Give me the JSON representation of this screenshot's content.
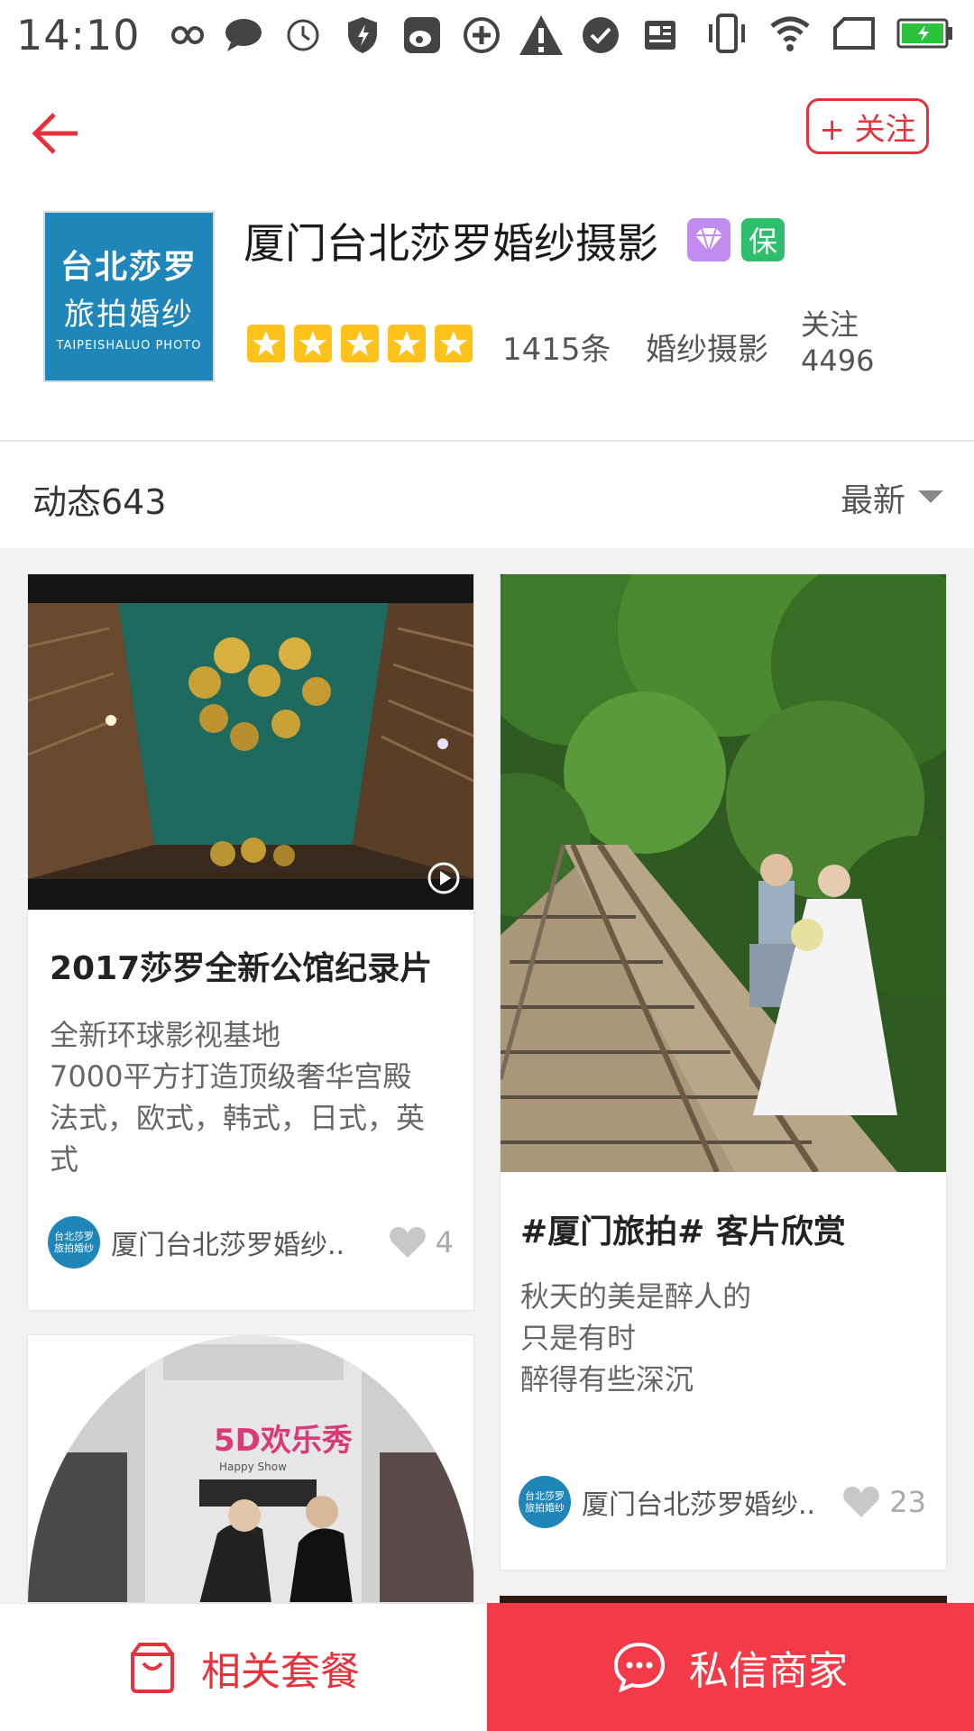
{
  "status_bar": {
    "time": "14:10",
    "icons": [
      "infinity-icon",
      "chat-bubble-icon",
      "clock-icon",
      "shield-icon",
      "weibo-icon",
      "sync-icon",
      "warning-icon",
      "check-circle-icon",
      "news-icon"
    ],
    "right_icons": [
      "vibrate-icon",
      "wifi-icon",
      "sim-icon",
      "battery-icon"
    ]
  },
  "header": {
    "follow_button": "+ 关注",
    "shop_name": "厦门台北莎罗婚纱摄影",
    "logo": {
      "line1": "台北莎罗",
      "line2": "旅拍婚纱",
      "line3": "TAIPEISHALUO PHOTO"
    },
    "badge_bao": "保",
    "rating_stars": 5,
    "review_count": "1415条",
    "category": "婚纱摄影",
    "follow_label": "关注",
    "follow_count": "4496"
  },
  "feed": {
    "count_label": "动态643",
    "sort_label": "最新"
  },
  "posts": [
    {
      "title": "2017莎罗全新公馆纪录片",
      "desc": [
        "全新环球影视基地",
        "7000平方打造顶级奢华宫殿",
        "法式，欧式，韩式，日式，英",
        "式"
      ],
      "author": "厦门台北莎罗婚纱..",
      "likes": "4"
    },
    {
      "title": "#厦门旅拍# 客片欣赏",
      "desc": [
        "秋天的美是醉人的",
        "只是有时",
        "醉得有些深沉"
      ],
      "author": "厦门台北莎罗婚纱..",
      "likes": "23"
    }
  ],
  "third_post_sign": {
    "brand": "5D欢乐秀",
    "sub": "Happy Show"
  },
  "avatar_text": {
    "line1": "台北莎罗",
    "line2": "旅拍婚纱"
  },
  "bottom_bar": {
    "packages": "相关套餐",
    "message": "私信商家"
  },
  "colors": {
    "accent": "#e5323c",
    "message_bg": "#f23a48",
    "star": "#ffc21a",
    "logo_bg": "#1e86b8"
  }
}
